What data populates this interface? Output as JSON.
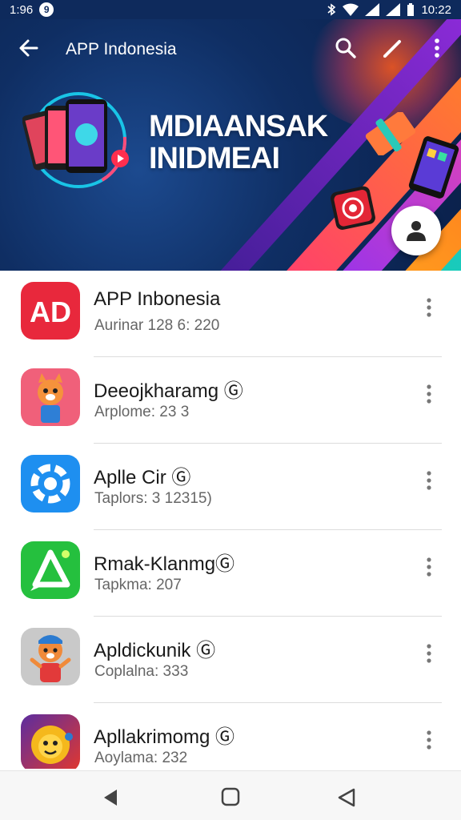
{
  "status_bar": {
    "time_left": "1:96",
    "notification_badge": "9",
    "time_right": "10:22"
  },
  "app_bar": {
    "title": "APP Indonesia",
    "icons": [
      "back-arrow-icon",
      "search-icon",
      "edit-icon",
      "more-vert-icon"
    ]
  },
  "banner": {
    "title_line1": "MDIAANSAK",
    "title_line2": "INIDMEAI"
  },
  "apps": [
    {
      "name": "APP Inbonesia",
      "subtitle": "Aurinar 128 6: 220",
      "icon": "ap-logo-icon",
      "color": "#e8283c"
    },
    {
      "name": "Deeojkharamg Ⓖ",
      "subtitle": "Arplome: 23 3",
      "icon": "fox-mascot-icon",
      "color": "#f0607a"
    },
    {
      "name": "Aplle Cir Ⓖ",
      "subtitle": "Taplors: 3 12315)",
      "icon": "gear-ring-icon",
      "color": "#1e8ff0"
    },
    {
      "name": "Rmak-KlanmgⒼ",
      "subtitle": "Tapkma: 207",
      "icon": "chat-leaf-icon",
      "color": "#25c03e"
    },
    {
      "name": "Apldickunik Ⓖ",
      "subtitle": "Coplalna: 333",
      "icon": "fox-character-icon",
      "color": "#c9c9c9"
    },
    {
      "name": "Apllakrimomg Ⓖ",
      "subtitle": "Aoylama: 232",
      "icon": "lion-mascot-icon",
      "color": "#5b2da0"
    }
  ],
  "nav_bar": {
    "icons": [
      "nav-back-icon",
      "nav-home-icon",
      "nav-recents-icon"
    ]
  }
}
